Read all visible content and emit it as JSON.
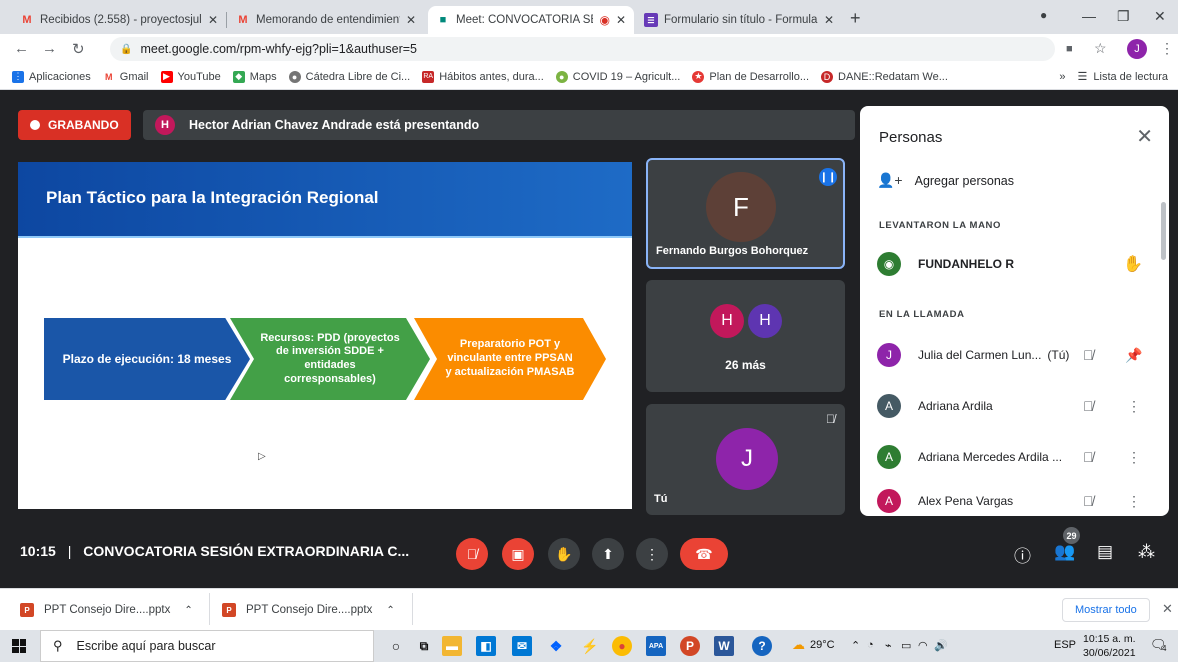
{
  "browser": {
    "tabs": [
      {
        "title": "Recibidos (2.558) - proyectosjulu",
        "icon": "gmail-icon"
      },
      {
        "title": "Memorando de entendimiento-C",
        "icon": "gmail-icon"
      },
      {
        "title": "Meet: CONVOCATORIA SESIC",
        "icon": "meet-icon",
        "active": true
      },
      {
        "title": "Formulario sin título - Formulario",
        "icon": "forms-icon"
      }
    ],
    "url": "meet.google.com/rpm-whfy-ejg?pli=1&authuser=5",
    "profile_initial": "J",
    "bookmarks": [
      {
        "label": "Aplicaciones",
        "icon": "apps-icon",
        "color": "#1a73e8"
      },
      {
        "label": "Gmail",
        "icon": "gmail-icon",
        "color": "#ea4335"
      },
      {
        "label": "YouTube",
        "icon": "youtube-icon",
        "color": "#ff0000"
      },
      {
        "label": "Maps",
        "icon": "maps-icon",
        "color": "#34a853"
      },
      {
        "label": "Cátedra Libre de Ci...",
        "icon": "site-icon",
        "color": "#757575"
      },
      {
        "label": "Hábitos antes, dura...",
        "icon": "ra-icon",
        "color": "#c62828"
      },
      {
        "label": "COVID 19 – Agricult...",
        "icon": "site-icon",
        "color": "#7cb342"
      },
      {
        "label": "Plan de Desarrollo...",
        "icon": "site-icon",
        "color": "#e53935"
      },
      {
        "label": "DANE::Redatam We...",
        "icon": "site-icon",
        "color": "#c62828"
      }
    ],
    "reading_list": "Lista de lectura",
    "more": "»"
  },
  "meet": {
    "recording_label": "GRABANDO",
    "presenter_initial": "H",
    "presenting_text": "Hector Adrian Chavez Andrade está presentando",
    "slide": {
      "title": "Plan Táctico para la Integración Regional",
      "steps": [
        "Plazo de ejecución: 18 meses",
        "Recursos: PDD (proyectos de inversión SDDE + entidades corresponsables)",
        "Preparatorio POT y vinculante entre PPSAN y actualización PMASAB"
      ]
    },
    "tiles": [
      {
        "name": "Fernando Burgos Bohorquez",
        "initial": "F",
        "color": "#5d4037"
      },
      {
        "initials": [
          "H",
          "H"
        ],
        "colors": [
          "#c2185b",
          "#5e35b1"
        ],
        "label": "26 más"
      },
      {
        "name": "Tú",
        "initial": "J",
        "color": "#8e24aa"
      }
    ],
    "people_panel": {
      "title": "Personas",
      "add_label": "Agregar personas",
      "raised_hands_header": "LEVANTARON LA MANO",
      "raised_hands": [
        {
          "name": "FUNDANHELO R"
        }
      ],
      "in_call_header": "EN LA LLAMADA",
      "participants": [
        {
          "initial": "J",
          "name": "Julia del Carmen Lun...",
          "suffix": "(Tú)",
          "color": "#8e24aa"
        },
        {
          "initial": "A",
          "name": "Adriana Ardila",
          "suffix": "",
          "color": "#455a64"
        },
        {
          "initial": "A",
          "name": "Adriana Mercedes Ardila ...",
          "suffix": "",
          "color": "#2e7d32"
        },
        {
          "initial": "A",
          "name": "Alex Pena Vargas",
          "suffix": "",
          "color": "#c2185b"
        }
      ]
    },
    "time": "10:15",
    "meeting_title": "CONVOCATORIA SESIÓN EXTRAORDINARIA C...",
    "participants_count": "29"
  },
  "downloads": {
    "items": [
      "PPT Consejo Dire....pptx",
      "PPT Consejo Dire....pptx"
    ],
    "show_all": "Mostrar todo"
  },
  "taskbar": {
    "search_placeholder": "Escribe aquí para buscar",
    "weather": "29°C",
    "language": "ESP",
    "time": "10:15 a. m.",
    "date": "30/06/2021",
    "notifications": "4"
  }
}
